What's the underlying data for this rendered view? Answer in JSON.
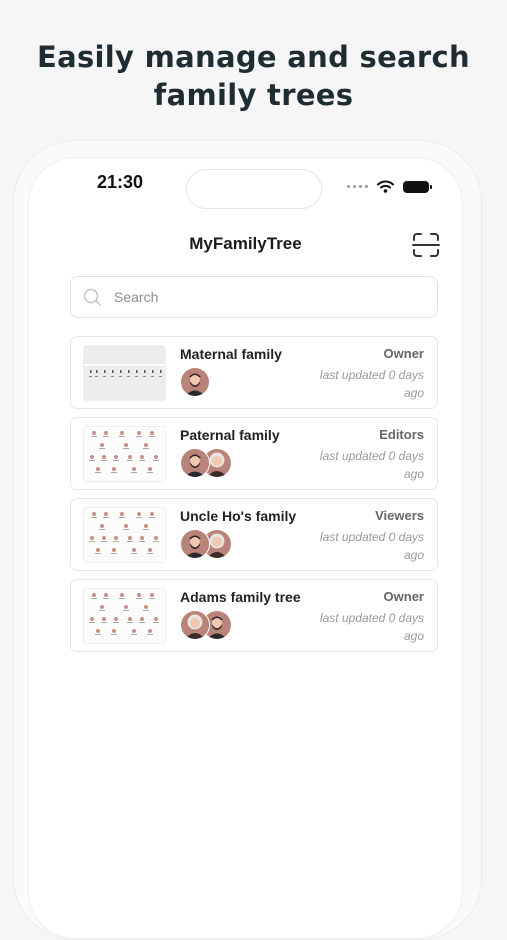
{
  "headline": {
    "line1": "Easily manage and search",
    "line2": "family trees"
  },
  "status_bar": {
    "time": "21:30"
  },
  "app": {
    "title": "MyFamilyTree",
    "search_placeholder": "Search",
    "trees": [
      {
        "name": "Maternal family",
        "role": "Owner",
        "updated": "last updated 0 days ago",
        "avatars": [
          "man-beard"
        ]
      },
      {
        "name": "Paternal family",
        "role": "Editors",
        "updated": "last updated 0 days ago",
        "avatars": [
          "man-beard",
          "woman"
        ]
      },
      {
        "name": "Uncle Ho's family",
        "role": "Viewers",
        "updated": "last updated 0 days ago",
        "avatars": [
          "man-beard",
          "woman"
        ]
      },
      {
        "name": "Adams family tree",
        "role": "Owner",
        "updated": "last updated 0 days ago",
        "avatars": [
          "woman",
          "man-beard"
        ]
      }
    ]
  },
  "colors": {
    "headline": "#1f2d33",
    "avatar_bg": "#b9837a",
    "text_muted": "#9a9a9a"
  }
}
